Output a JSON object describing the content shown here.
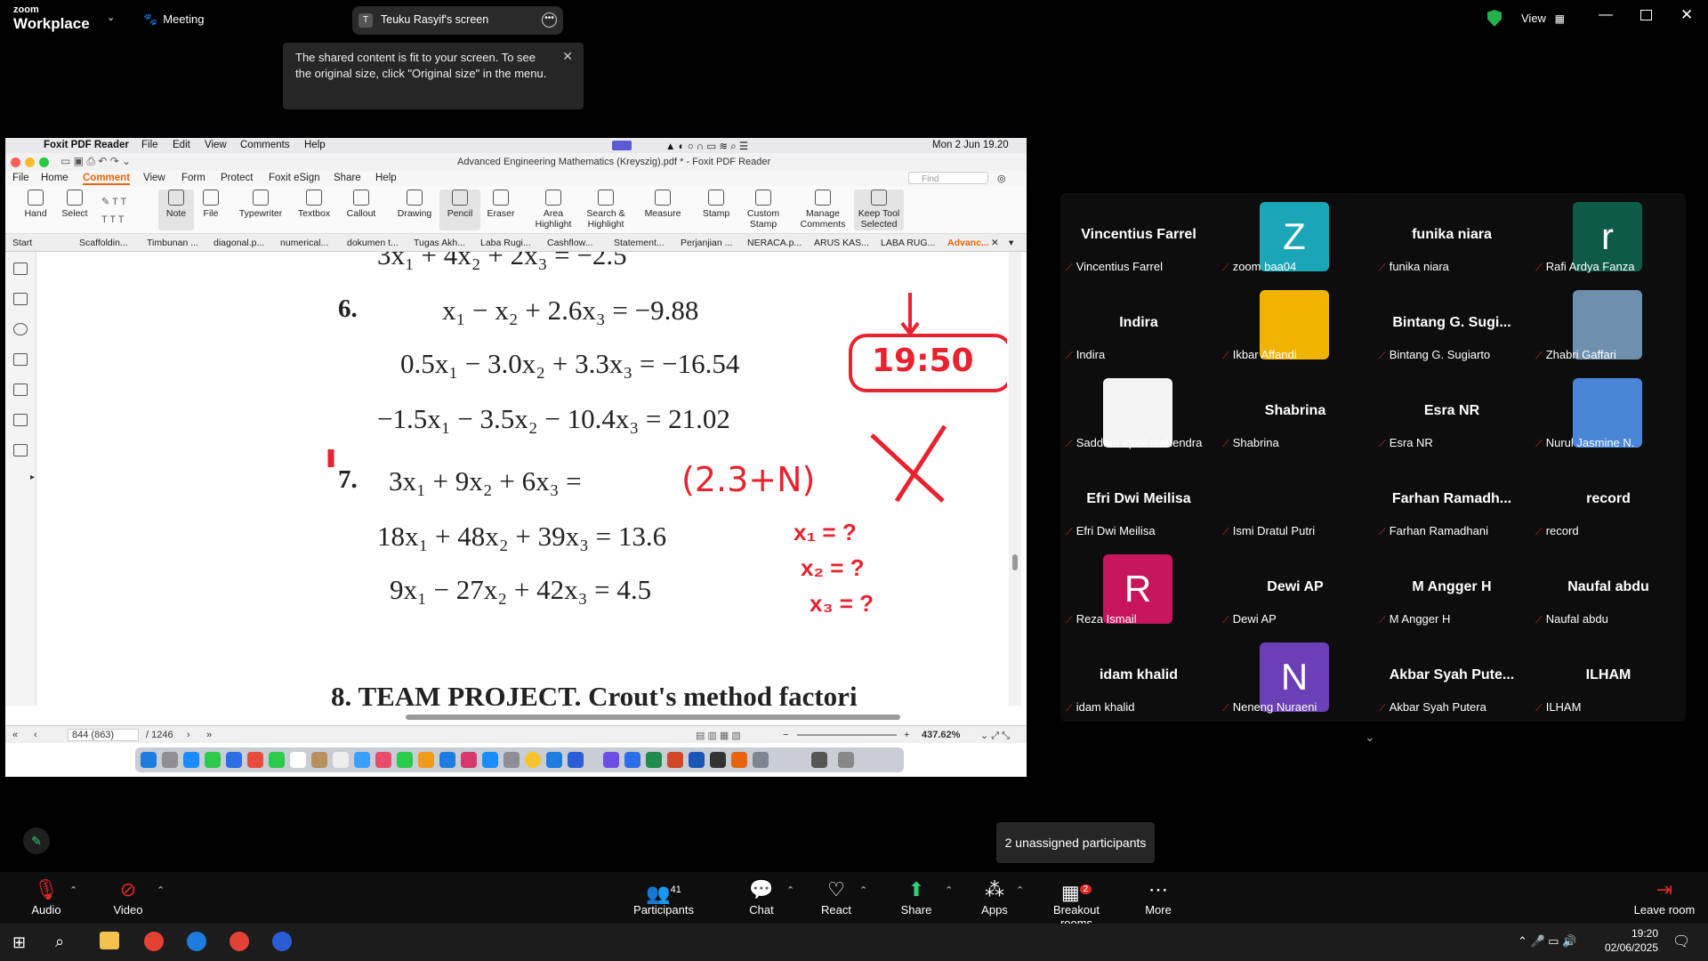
{
  "zoom": {
    "brand_top": "zoom",
    "brand_bottom": "Workplace",
    "meeting_label": "Meeting",
    "share_pill_initial": "T",
    "share_pill_label": "Teuku Rasyif's screen",
    "view_label": "View",
    "tooltip_text": "The shared content is fit to your screen. To see the original size, click \"Original size\" in the menu."
  },
  "foxit": {
    "mac_menu": [
      "Foxit PDF Reader",
      "File",
      "Edit",
      "View",
      "Comments",
      "Help"
    ],
    "mac_clock": "Mon 2 Jun  19.20",
    "window_title": "Advanced Engineering Mathematics (Kreyszig).pdf * - Foxit PDF Reader",
    "menu": [
      "File",
      "Home",
      "Comment",
      "View",
      "Form",
      "Protect",
      "Foxit eSign",
      "Share",
      "Help"
    ],
    "find_placeholder": "Find",
    "ribbon": [
      {
        "label": "Hand"
      },
      {
        "label": "Select"
      },
      {
        "label": "Note"
      },
      {
        "label": "File"
      },
      {
        "label": "Typewriter"
      },
      {
        "label": "Textbox"
      },
      {
        "label": "Callout"
      },
      {
        "label": "Drawing"
      },
      {
        "label": "Pencil"
      },
      {
        "label": "Eraser"
      },
      {
        "label": "Area Highlight"
      },
      {
        "label": "Search & Highlight"
      },
      {
        "label": "Measure"
      },
      {
        "label": "Stamp"
      },
      {
        "label": "Custom Stamp"
      },
      {
        "label": "Manage Comments"
      },
      {
        "label": "Keep Tool Selected"
      }
    ],
    "tabs": [
      "Start",
      "Scaffoldin...",
      "Timbunan ...",
      "diagonal.p...",
      "numerical...",
      "dokumen t...",
      "Tugas Akh...",
      "Laba Rugi...",
      "Cashflow...",
      "Statement...",
      "Perjanjian ...",
      "NERACA.p...",
      "ARUS KAS...",
      "LABA RUG...",
      "Advanc..."
    ],
    "page_current": "844 (863)",
    "page_total": "/ 1246",
    "zoom_level": "437.62%",
    "doc": {
      "p6_num": "6.",
      "p6_l1": "x₁ −   x₂ +  2.6x₃ =   −9.88",
      "p6_l2": "0.5x₁ − 3.0x₂ +  3.3x₃ = −16.54",
      "p6_l3": "−1.5x₁ − 3.5x₂ − 10.4x₃ =   21.02",
      "p7_num": "7.",
      "p7_l1": "3x₁ +  9x₂ +  6x₃ =",
      "p7_l2": "18x₁ + 48x₂ + 39x₃ = 13.6",
      "p7_l3": "9x₁ − 27x₂ + 42x₃ =   4.5",
      "top_cut": "3x₁ + 4x₂ + 2x₃ = −2.5",
      "bottom_cut": "8. TEAM PROJECT. Crout's method factori",
      "ink_time": "19:50",
      "ink_bracket": "(2.3+N)",
      "ink_x1": "x₁ = ?",
      "ink_x2": "x₂ = ?",
      "ink_x3": "x₃ = ?"
    }
  },
  "gallery": {
    "tiles": [
      {
        "name": "Vincentius Farrel",
        "label": "Vincentius Farrel",
        "avatar": "",
        "color": ""
      },
      {
        "name": "",
        "label": "zoom baa04",
        "avatar": "Z",
        "color": "#1aa6b7"
      },
      {
        "name": "funika niara",
        "label": "funika niara",
        "avatar": "",
        "color": ""
      },
      {
        "name": "",
        "label": "Rafi Ardya Fanza",
        "avatar": "r",
        "color": "#0e5a48"
      },
      {
        "name": "Indira",
        "label": "Indira",
        "avatar": "",
        "color": ""
      },
      {
        "name": "",
        "label": "Ikbar Affandi",
        "avatar": "img",
        "color": "#f0b400"
      },
      {
        "name": "Bintang G. Sugi...",
        "label": "Bintang G. Sugiarto",
        "avatar": "",
        "color": ""
      },
      {
        "name": "",
        "label": "Zhabri Gaffari",
        "avatar": "img",
        "color": "#6f8fae"
      },
      {
        "name": "",
        "label": "Saddam iqbal mahendra",
        "avatar": "img",
        "color": "#f4f4f4"
      },
      {
        "name": "Shabrina",
        "label": "Shabrina",
        "avatar": "",
        "color": ""
      },
      {
        "name": "Esra NR",
        "label": "Esra NR",
        "avatar": "",
        "color": ""
      },
      {
        "name": "",
        "label": "Nurul Jasmine N.",
        "avatar": "img",
        "color": "#4a86d8"
      },
      {
        "name": "Efri Dwi Meilisa",
        "label": "Efri Dwi Meilisa",
        "avatar": "",
        "color": ""
      },
      {
        "name": "",
        "label": "Ismi Dratul Putri",
        "avatar": "",
        "color": ""
      },
      {
        "name": "Farhan Ramadh...",
        "label": "Farhan Ramadhani",
        "avatar": "",
        "color": ""
      },
      {
        "name": "record",
        "label": "record",
        "avatar": "",
        "color": ""
      },
      {
        "name": "",
        "label": "Reza Ismail",
        "avatar": "R",
        "color": "#c8165c"
      },
      {
        "name": "Dewi AP",
        "label": "Dewi AP",
        "avatar": "",
        "color": ""
      },
      {
        "name": "M Angger H",
        "label": "M Angger H",
        "avatar": "",
        "color": ""
      },
      {
        "name": "Naufal abdu",
        "label": "Naufal abdu",
        "avatar": "",
        "color": ""
      },
      {
        "name": "idam khalid",
        "label": "idam khalid",
        "avatar": "",
        "color": ""
      },
      {
        "name": "",
        "label": "Neneng Nuraeni",
        "avatar": "N",
        "color": "#6b3fb5"
      },
      {
        "name": "Akbar Syah Pute...",
        "label": "Akbar Syah Putera",
        "avatar": "",
        "color": ""
      },
      {
        "name": "ILHAM",
        "label": "ILHAM",
        "avatar": "",
        "color": ""
      }
    ],
    "unassigned": "2 unassigned participants"
  },
  "toolbar": {
    "audio": "Audio",
    "video": "Video",
    "participants": "Participants",
    "participants_count": "41",
    "chat": "Chat",
    "react": "React",
    "share": "Share",
    "apps": "Apps",
    "breakout": "Breakout rooms",
    "breakout_badge": "2",
    "more": "More",
    "leave": "Leave room"
  },
  "taskbar": {
    "time": "19:20",
    "date": "02/06/2025"
  }
}
